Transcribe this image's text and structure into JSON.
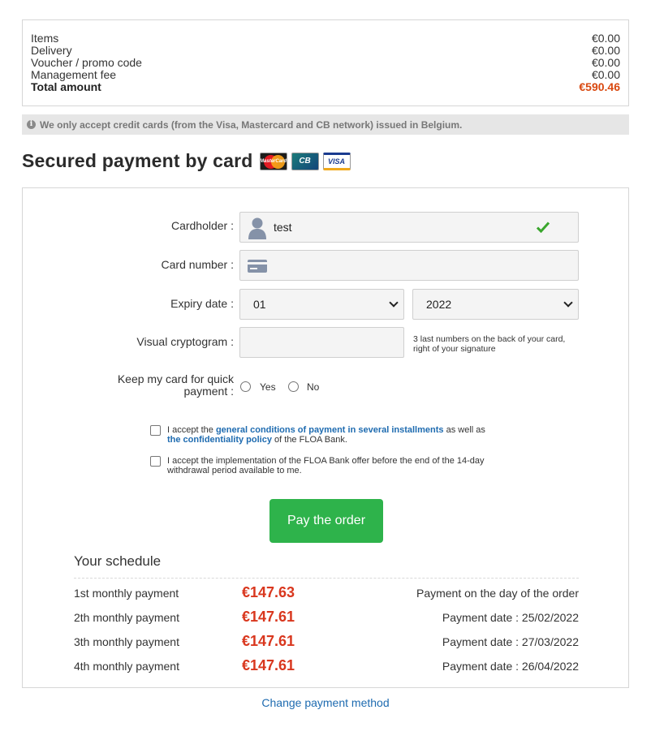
{
  "summary": {
    "items_label": "Items",
    "items_value": "€0.00",
    "delivery_label": "Delivery",
    "delivery_value": "€0.00",
    "voucher_label": "Voucher / promo code",
    "voucher_value": "€0.00",
    "fee_label": "Management fee",
    "fee_value": "€0.00",
    "total_label": "Total amount",
    "total_value": "€590.46"
  },
  "notice": {
    "text": "We only accept credit cards (from the Visa, Mastercard and CB network) issued in Belgium.",
    "icon": "info-icon"
  },
  "heading": {
    "title": "Secured payment by card",
    "logos": [
      "MasterCard",
      "CB",
      "VISA"
    ]
  },
  "form": {
    "cardholder_label": "Cardholder :",
    "cardholder_value": "test",
    "card_number_label": "Card number :",
    "expiry_label": "Expiry date :",
    "expiry_month": "01",
    "expiry_year": "2022",
    "cryptogram_label": "Visual cryptogram :",
    "cryptogram_hint_1": "3 last numbers on the back of your card,",
    "cryptogram_hint_2": "right of your signature",
    "keep_label_1": "Keep my card for quick",
    "keep_label_2": "payment :",
    "keep_yes": "Yes",
    "keep_no": "No",
    "accept1_pre": "I accept the",
    "accept1_link1": "general conditions of payment in several installments",
    "accept1_mid": "as well as",
    "accept1_link2": "the confidentiality policy",
    "accept1_post": "of the FLOA Bank.",
    "accept2_line1": "I accept the implementation of the FLOA Bank offer before the end of the 14-day",
    "accept2_line2": "withdrawal period available to me.",
    "pay_button": "Pay the order"
  },
  "schedule": {
    "title": "Your schedule",
    "rows": [
      {
        "name": "1st monthly payment",
        "amount": "€147.63",
        "date": "Payment on the day of the order"
      },
      {
        "name": "2th monthly payment",
        "amount": "€147.61",
        "date": "Payment date : 25/02/2022"
      },
      {
        "name": "3th monthly payment",
        "amount": "€147.61",
        "date": "Payment date : 27/03/2022"
      },
      {
        "name": "4th monthly payment",
        "amount": "€147.61",
        "date": "Payment date : 26/04/2022"
      }
    ]
  },
  "footer": {
    "change_link": "Change payment method"
  },
  "colors": {
    "accent_orange": "#d9480f",
    "pay_green": "#2eb34b",
    "amount_red": "#d9371e",
    "link_blue": "#1e6bb0",
    "check_green": "#3aa62d"
  }
}
